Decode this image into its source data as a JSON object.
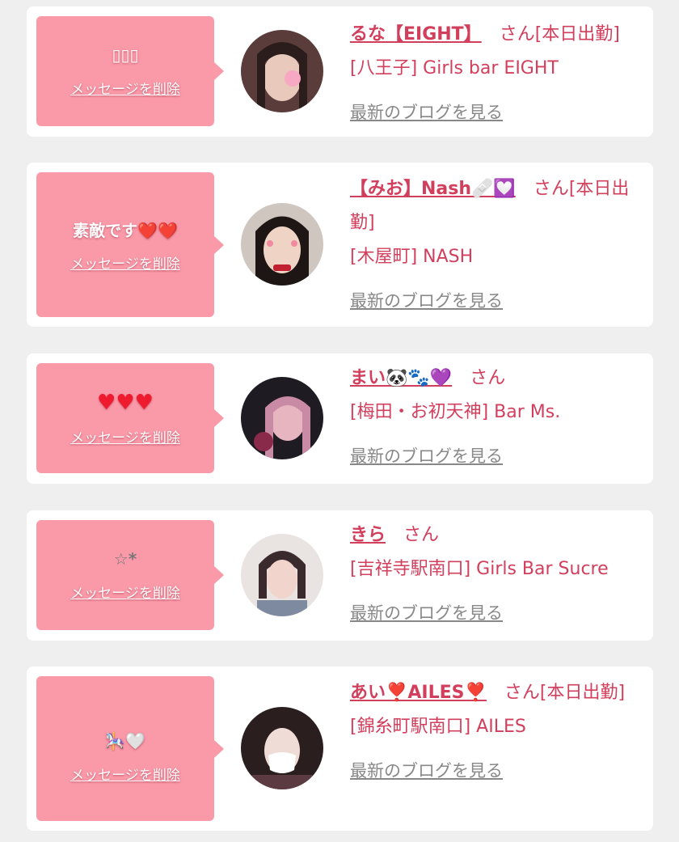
{
  "cards": [
    {
      "message": "▯▯▯",
      "delete_label": "メッセージを削除",
      "name": "るな【EIGHT】",
      "suffix": "さん[本日出勤]",
      "shop": "[八王子] Girls bar EIGHT",
      "blog_label": "最新のブログを見る",
      "avatar_colors": [
        "#5a3d3a",
        "#e8c9bb",
        "#2a1d1c"
      ]
    },
    {
      "message": "素敵です❤️❤️",
      "delete_label": "メッセージを削除",
      "name": "【みお】Nash🩹💟",
      "suffix": "さん[本日出勤]",
      "shop": "[木屋町] NASH",
      "blog_label": "最新のブログを見る",
      "avatar_colors": [
        "#cfc6c0",
        "#efd3c5",
        "#1d1614"
      ]
    },
    {
      "message": "♥♥♥",
      "delete_label": "メッセージを削除",
      "name": "まい🐼🐾💜",
      "suffix": "さん",
      "shop": "[梅田・お初天神] Bar Ms.",
      "blog_label": "最新のブログを見る",
      "avatar_colors": [
        "#1f1b22",
        "#e6b5c0",
        "#c98aa5"
      ]
    },
    {
      "message": "☆*",
      "delete_label": "メッセージを削除",
      "name": "きら",
      "suffix": "さん",
      "shop": "[吉祥寺駅南口] Girls Bar Sucre",
      "blog_label": "最新のブログを見る",
      "avatar_colors": [
        "#e9e3e2",
        "#f1d5cc",
        "#3a2a2d"
      ]
    },
    {
      "message": "🎠🤍",
      "delete_label": "メッセージを削除",
      "name": "あい❣️AILES❣️",
      "suffix": "さん[本日出勤]",
      "shop": "[錦糸町駅南口] AILES",
      "blog_label": "最新のブログを見る",
      "avatar_colors": [
        "#2b1e1f",
        "#f0dcd6",
        "#5b3a41"
      ]
    }
  ]
}
